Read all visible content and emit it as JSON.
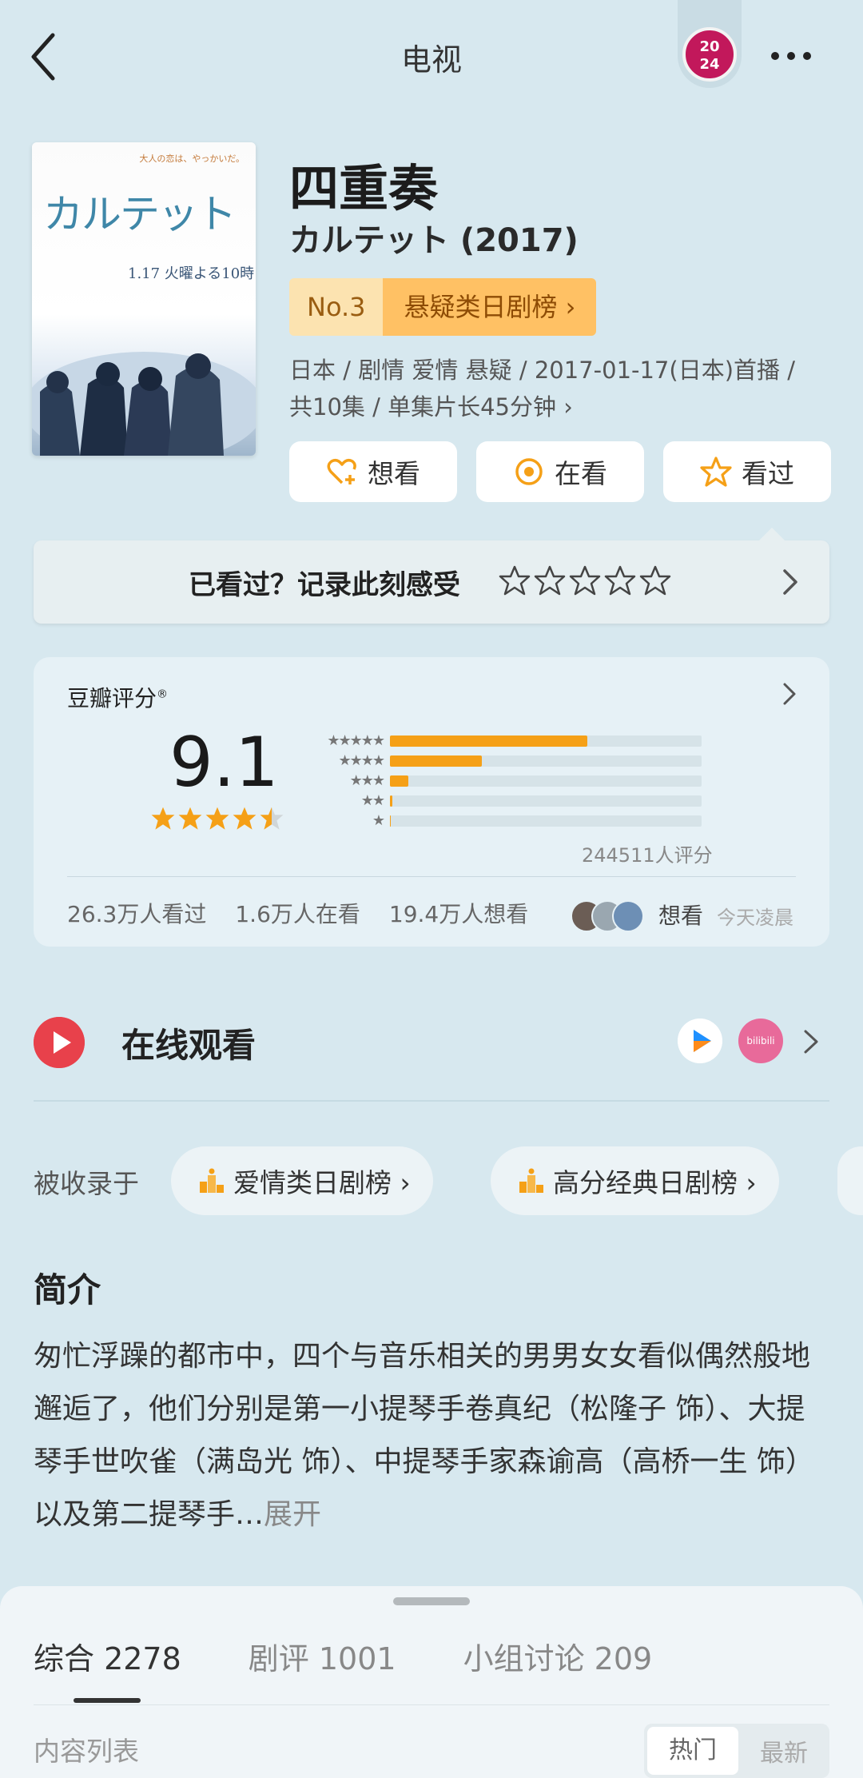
{
  "header": {
    "title": "电视",
    "badge_text": "20\n24",
    "back_icon": "chevron-left-icon",
    "more_icon": "more-horizontal-icon"
  },
  "poster": {
    "tagline": "大人の恋は、やっかいだ。",
    "title": "カルテット",
    "date": "1.17 火曜よる10時"
  },
  "title": "四重奏",
  "subtitle": "カルテット (2017)",
  "rank": {
    "number": "No.3",
    "label": "悬疑类日剧榜 ›"
  },
  "meta": {
    "line1": "日本 / 剧情 爱情 悬疑 / 2017-01-17(日本)首播 /",
    "line2": "共10集 / 单集片长45分钟 ›"
  },
  "actions": [
    {
      "label": "想看",
      "icon": "heart-plus-icon"
    },
    {
      "label": "在看",
      "icon": "circle-dot-icon"
    },
    {
      "label": "看过",
      "icon": "star-outline-icon"
    }
  ],
  "record_prompt": "已看过？记录此刻感受",
  "rating": {
    "label": "豆瓣评分",
    "label_mark": "®",
    "score": "9.1",
    "star_level": 4.5,
    "distribution": [
      {
        "stars": "★★★★★",
        "percent": 63.3
      },
      {
        "stars": "★★★★",
        "percent": 29.6
      },
      {
        "stars": "★★★",
        "percent": 5.8
      },
      {
        "stars": "★★",
        "percent": 0.8
      },
      {
        "stars": "★",
        "percent": 0.3
      }
    ],
    "count_text": "244511人评分",
    "watched": "26.3万人看过",
    "watching": "1.6万人在看",
    "wanted": "19.4万人想看",
    "friend_action": "想看",
    "friend_time": "今天凌晨"
  },
  "online": {
    "label": "在线观看",
    "app2_text": "bilibili"
  },
  "collected": {
    "label": "被收录于",
    "chips": [
      "爱情类日剧榜 ›",
      "高分经典日剧榜 ›"
    ]
  },
  "intro": {
    "heading": "简介",
    "text": "匆忙浮躁的都市中，四个与音乐相关的男男女女看似偶然般地邂逅了，他们分别是第一小提琴手卷真纪（松隆子 饰）、大提琴手世吹雀（满岛光 饰）、中提琴手家森谕高（高桥一生 饰）以及第二提琴手…",
    "expand": "展开"
  },
  "bottom_tabs": {
    "tabs": [
      "综合 2278",
      "剧评 1001",
      "小组讨论 209"
    ],
    "list_label": "内容列表",
    "sort_hot": "热门",
    "sort_new": "最新"
  },
  "colors": {
    "background": "#d7e8ef",
    "accent_orange": "#f5a017",
    "play_red": "#e8414b"
  }
}
